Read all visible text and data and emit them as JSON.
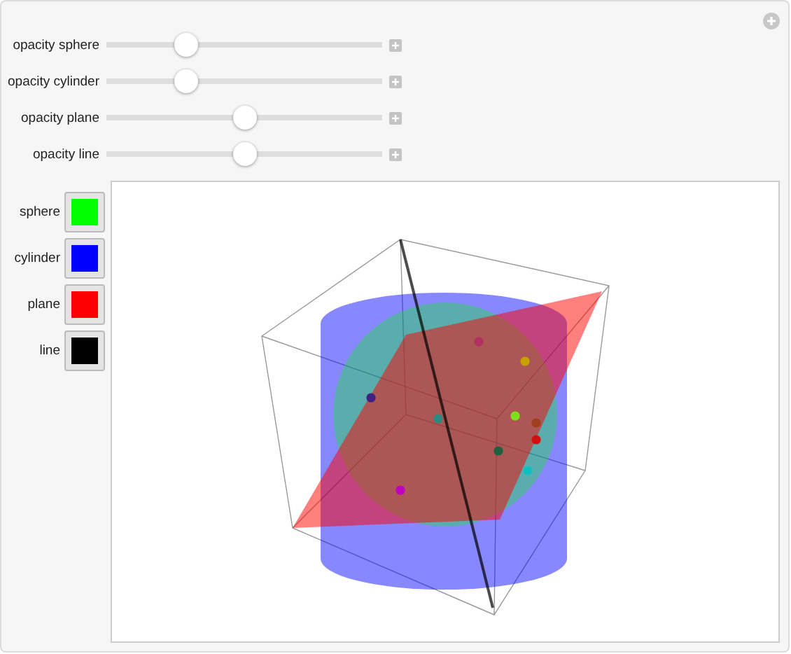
{
  "controls": [
    {
      "label": "opacity sphere",
      "level": 0.27
    },
    {
      "label": "opacity cylinder",
      "level": 0.27
    },
    {
      "label": "opacity plane",
      "level": 0.5
    },
    {
      "label": "opacity line",
      "level": 0.5
    }
  ],
  "swatches": [
    {
      "label": "sphere",
      "color": "#00ff00"
    },
    {
      "label": "cylinder",
      "color": "#0000ff"
    },
    {
      "label": "plane",
      "color": "#ff0000"
    },
    {
      "label": "line",
      "color": "#000000"
    }
  ]
}
